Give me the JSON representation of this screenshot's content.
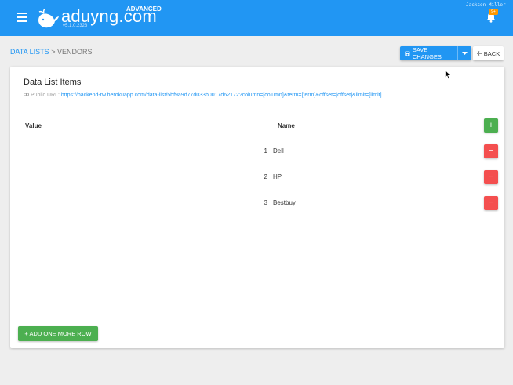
{
  "header": {
    "logo_text": "aduyng.com",
    "edition": "ADVANCED",
    "version": "v5.1.0.2323",
    "user_name": "Jackson Miller",
    "notification_count": "9+"
  },
  "breadcrumb": {
    "parent": "DATA LISTS",
    "separator": ">",
    "current": "VENDORS"
  },
  "toolbar": {
    "save_label": "SAVE CHANGES",
    "back_label": "BACK"
  },
  "card": {
    "title": "Data List Items",
    "public_url_label": "Public URL:",
    "public_url": "https://backend-rw.herokuapp.com/data-list/5bf9a9d77d033b0017d62172?column=[column]&term=[term]&offset=[offset]&limit=[limit]"
  },
  "table": {
    "columns": [
      "Value",
      "Name"
    ],
    "add_icon": "+",
    "remove_icon": "−",
    "rows": [
      {
        "index": "1",
        "name": "Dell"
      },
      {
        "index": "2",
        "name": "HP"
      },
      {
        "index": "3",
        "name": "Bestbuy"
      }
    ]
  },
  "footer": {
    "add_row_label": "+ ADD ONE MORE ROW"
  },
  "colors": {
    "primary": "#2196f3",
    "success": "#4caf50",
    "danger": "#f44f4f",
    "badge": "#ff9800"
  }
}
